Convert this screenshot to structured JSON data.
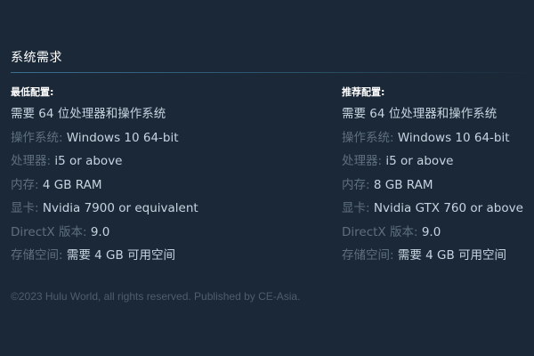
{
  "section": {
    "title": "系统需求"
  },
  "minimum": {
    "title": "最低配置:",
    "requirement": "需要 64 位处理器和操作系统",
    "items": [
      {
        "label": "操作系统:",
        "value": "Windows 10 64-bit"
      },
      {
        "label": "处理器:",
        "value": "i5 or above"
      },
      {
        "label": "内存:",
        "value": "4 GB RAM"
      },
      {
        "label": "显卡:",
        "value": "Nvidia 7900 or equivalent"
      },
      {
        "label": "DirectX 版本:",
        "value": "9.0"
      },
      {
        "label": "存储空间:",
        "value": "需要 4 GB 可用空间"
      }
    ]
  },
  "recommended": {
    "title": "推荐配置:",
    "requirement": "需要 64 位处理器和操作系统",
    "items": [
      {
        "label": "操作系统:",
        "value": "Windows 10 64-bit"
      },
      {
        "label": "处理器:",
        "value": "i5 or above"
      },
      {
        "label": "内存:",
        "value": "8 GB RAM"
      },
      {
        "label": "显卡:",
        "value": "Nvidia GTX 760 or above"
      },
      {
        "label": "DirectX 版本:",
        "value": "9.0"
      },
      {
        "label": "存储空间:",
        "value": "需要 4 GB 可用空间"
      }
    ]
  },
  "footer": {
    "text": "©2023 Hulu World, all rights reserved. Published by CE-Asia."
  },
  "colors": {
    "background": "#1b2838",
    "label": "#5e6f7e",
    "value": "#c6d4df",
    "title": "#ffffff",
    "footer": "#4e5e6c"
  }
}
